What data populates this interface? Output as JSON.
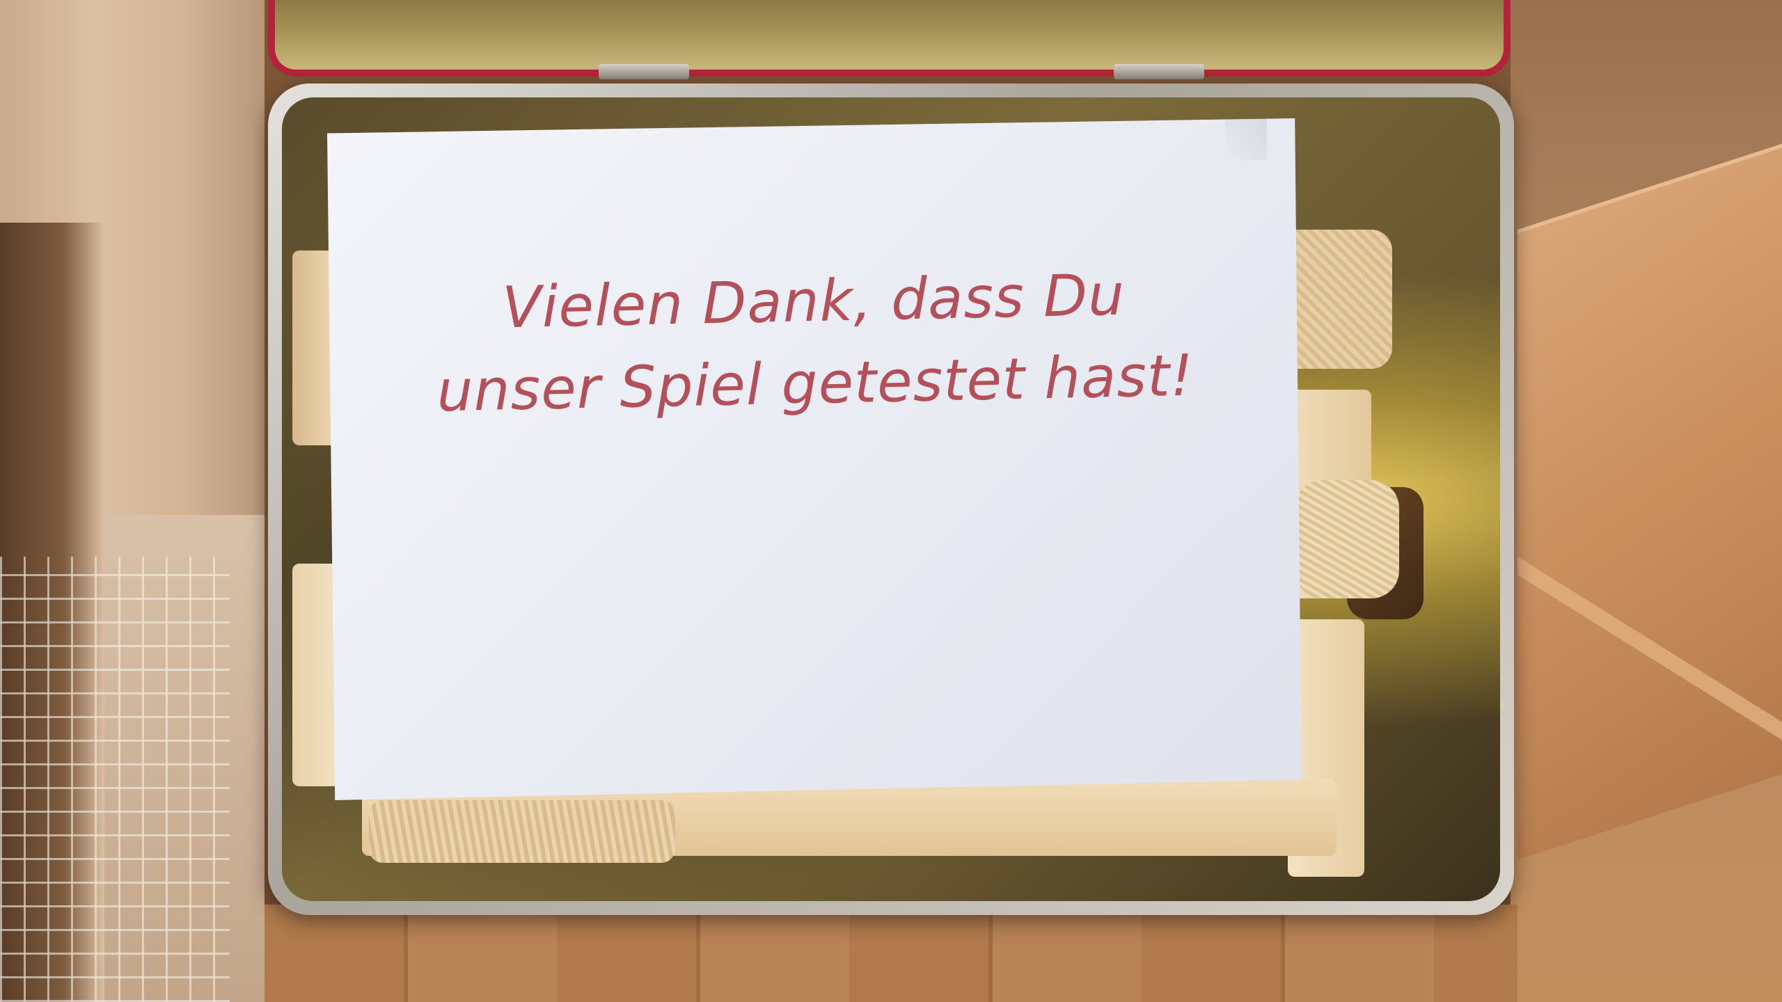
{
  "message": {
    "line1": "Vielen Dank, dass Du",
    "line2": "unser Spiel getestet hast!"
  },
  "colors": {
    "message_text": "#b3505a",
    "paper": "#f4f5fa",
    "tin_lid_rim": "#b3243a"
  }
}
